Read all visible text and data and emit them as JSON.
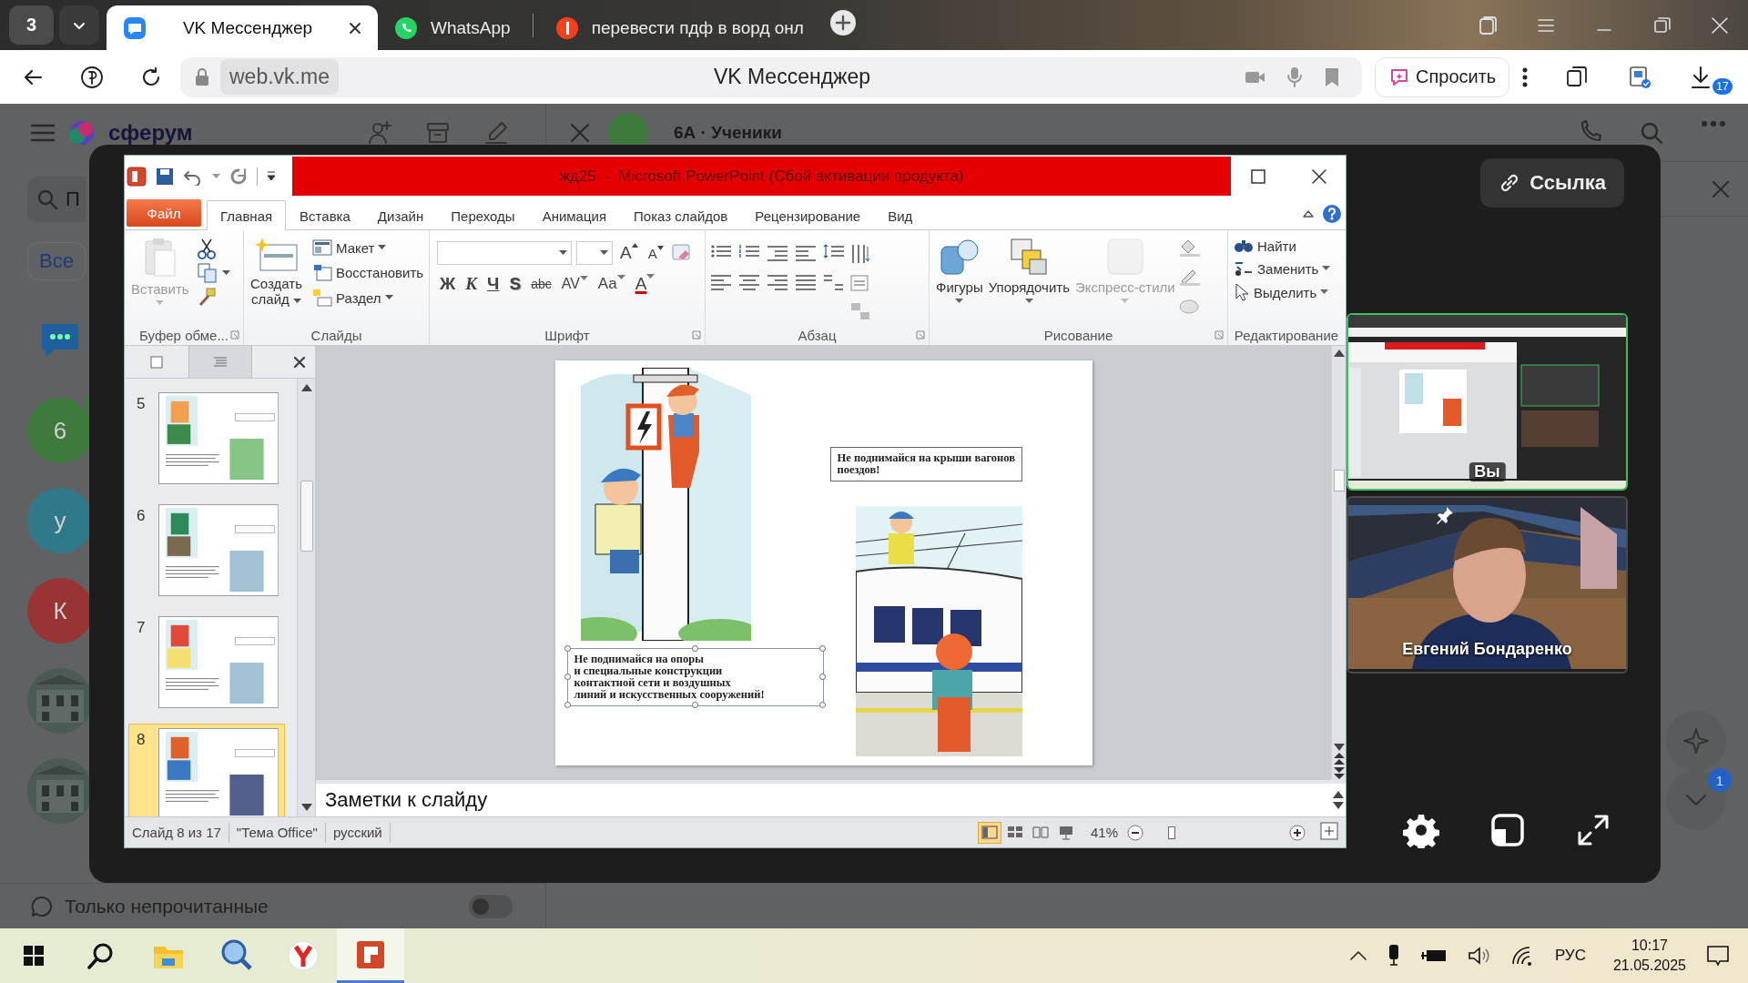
{
  "browser": {
    "tab_count": "3",
    "tabs": [
      {
        "kind": "vk",
        "title": "VK Мессенджер",
        "selected": true
      },
      {
        "kind": "whatsapp",
        "title": "WhatsApp",
        "selected": false
      },
      {
        "kind": "yandex",
        "title": "перевести пдф в ворд онл",
        "selected": false
      }
    ],
    "address": "web.vk.me",
    "page_title": "VK Мессенджер",
    "ask_button": "Спросить",
    "downloads_badge": "17"
  },
  "messenger": {
    "logo": "сферум",
    "search": {
      "placeholder": "П"
    },
    "filter": "Все",
    "chats": [
      {
        "kind": "initial",
        "initial": "6",
        "color": "#3e7a3c",
        "in_call": true
      },
      {
        "kind": "initial",
        "initial": "у",
        "color": "#2f7a8a",
        "in_call": false
      },
      {
        "kind": "initial",
        "initial": "К",
        "color": "#983434",
        "in_call": false
      },
      {
        "kind": "picture",
        "in_call": false
      },
      {
        "kind": "picture",
        "in_call": false
      }
    ],
    "unread_only": {
      "label": "Только непрочитанные",
      "on": false
    },
    "chat_title": "6А · Ученики",
    "new_badge": "1"
  },
  "call": {
    "link_button": "Ссылка",
    "participants": [
      {
        "name": "Вы",
        "speaking": true,
        "pinned": false
      },
      {
        "name": "Евгений Бондаренко",
        "speaking": false,
        "pinned": true
      }
    ]
  },
  "powerpoint": {
    "title": "жд25  -  Microsoft PowerPoint (Сбой активации продукта)",
    "file_tab": "Файл",
    "tabs": [
      {
        "label": "Главная",
        "selected": true
      },
      {
        "label": "Вставка",
        "selected": false
      },
      {
        "label": "Дизайн",
        "selected": false
      },
      {
        "label": "Переходы",
        "selected": false
      },
      {
        "label": "Анимация",
        "selected": false
      },
      {
        "label": "Показ слайдов",
        "selected": false
      },
      {
        "label": "Рецензирование",
        "selected": false
      },
      {
        "label": "Вид",
        "selected": false
      }
    ],
    "ribbon": {
      "clipboard": {
        "label": "Буфер обме...",
        "paste": {
          "label": "Вставить",
          "disabled": true
        }
      },
      "slides": {
        "label": "Слайды",
        "new_slide": "Создать слайд",
        "layout": "Макет",
        "reset": "Восстановить",
        "section": "Раздел"
      },
      "font": {
        "label": "Шрифт",
        "grow": "A",
        "shrink": "A",
        "styles": [
          "Ж",
          "К",
          "Ч",
          "S",
          "abc",
          "AV",
          "Aa",
          "A"
        ]
      },
      "paragraph": {
        "label": "Абзац"
      },
      "drawing": {
        "label": "Рисование",
        "buttons": [
          {
            "label": "Фигуры",
            "disabled": false
          },
          {
            "label": "Упорядочить",
            "disabled": false
          },
          {
            "label": "Экспресс-стили",
            "disabled": true
          }
        ]
      },
      "editing": {
        "label": "Редактирование",
        "buttons": [
          "Найти",
          "Заменить",
          "Выделить"
        ]
      }
    },
    "slides": [
      {
        "number": "5",
        "selected": false
      },
      {
        "number": "6",
        "selected": false
      },
      {
        "number": "7",
        "selected": false
      },
      {
        "number": "8",
        "selected": true
      }
    ],
    "slide": {
      "captions": [
        {
          "text": "Не поднимайся на крыши вагонов\nпоездов!",
          "selected": false
        },
        {
          "text": "Не поднимайся на опоры\nи специальные конструкции\nконтактной сети и воздушных\nлиний и искусственных сооружений!",
          "selected": true
        }
      ]
    },
    "notes": {
      "placeholder": "Заметки к слайду"
    },
    "status": [
      "Слайд 8 из 17",
      "\"Тема Office\"",
      "русский"
    ],
    "views": [
      {
        "selected": true
      },
      {
        "selected": false
      },
      {
        "selected": false
      },
      {
        "selected": false
      }
    ],
    "zoom": {
      "reading": "41%",
      "level": 0.17
    }
  },
  "taskbar": {
    "apps": [
      {
        "kind": "explorer",
        "selected": false
      },
      {
        "kind": "magnifier",
        "selected": false
      },
      {
        "kind": "browser",
        "selected": false
      },
      {
        "kind": "powerpoint",
        "selected": true
      }
    ],
    "language": "РУС",
    "time": "10:17",
    "date": "21.05.2025"
  }
}
